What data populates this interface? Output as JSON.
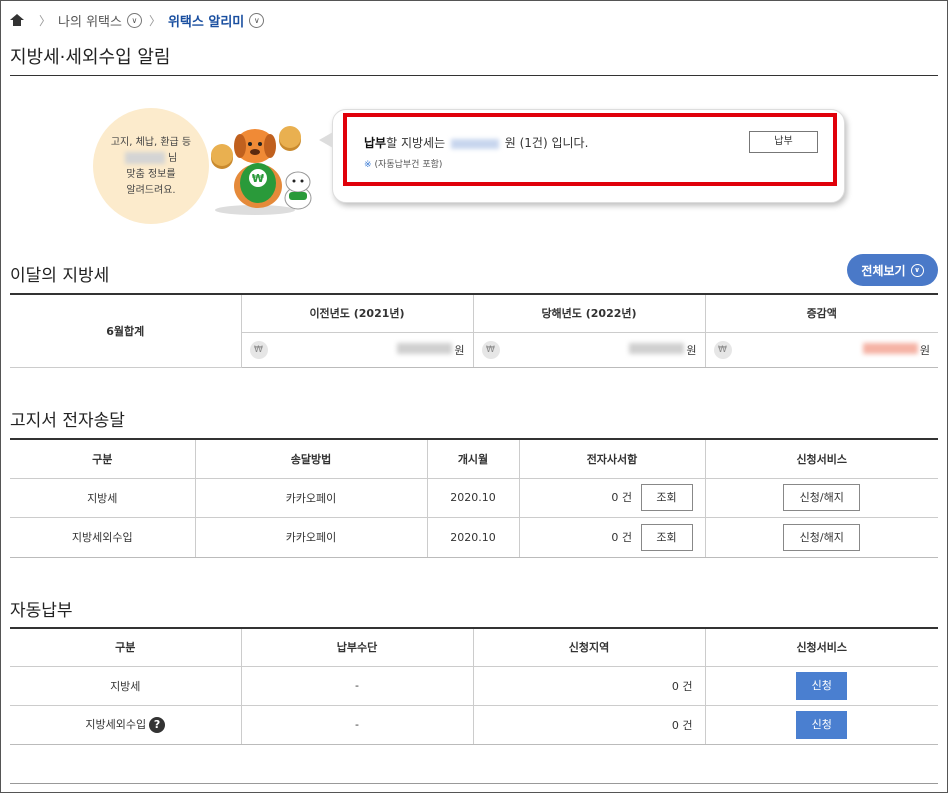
{
  "breadcrumb": {
    "level1": "나의 위택스",
    "level2": "위택스 알리미"
  },
  "page_title": "지방세·세외수입 알림",
  "banner": {
    "greeting_line1": "고지, 체납, 환급 등",
    "greeting_line2_suffix": "님",
    "greeting_line3": "맞춤 정보를",
    "greeting_line4": "알려드려요.",
    "pay_prefix_bold": "납부",
    "pay_prefix_rest": "할 지방세는",
    "pay_suffix": "원 (1건) 입니다.",
    "note_mark": "※",
    "note": "(자동납부건 포함)",
    "pay_button": "납부"
  },
  "monthly": {
    "title": "이달의 지방세",
    "view_all": "전체보기",
    "row_label": "6월합계",
    "columns": [
      "이전년도 (2021년)",
      "당해년도 (2022년)",
      "증감액"
    ],
    "currency_symbol": "₩",
    "unit": "원"
  },
  "electronic": {
    "title": "고지서 전자송달",
    "headers": [
      "구분",
      "송달방법",
      "개시월",
      "전자사서함",
      "신청서비스"
    ],
    "rows": [
      {
        "type": "지방세",
        "method": "카카오페이",
        "start": "2020.10",
        "count": "0 건",
        "view": "조회",
        "service": "신청/해지"
      },
      {
        "type": "지방세외수입",
        "method": "카카오페이",
        "start": "2020.10",
        "count": "0 건",
        "view": "조회",
        "service": "신청/해지"
      }
    ]
  },
  "autopay": {
    "title": "자동납부",
    "headers": [
      "구분",
      "납부수단",
      "신청지역",
      "신청서비스"
    ],
    "rows": [
      {
        "type": "지방세",
        "means": "-",
        "region": "0 건",
        "service": "신청"
      },
      {
        "type": "지방세외수입",
        "means": "-",
        "region": "0 건",
        "service": "신청",
        "help": "?"
      }
    ]
  }
}
